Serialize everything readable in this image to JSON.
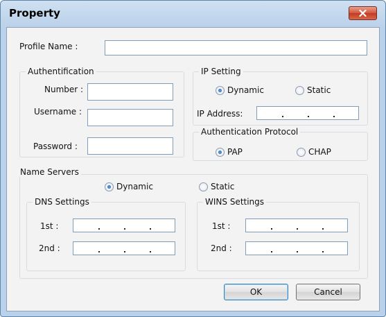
{
  "window": {
    "title": "Property"
  },
  "profile": {
    "label": "Profile Name :",
    "value": ""
  },
  "authentication": {
    "group_label": "Authentification",
    "number_label": "Number :",
    "username_label": "Username :",
    "password_label": "Password  :",
    "number_value": "",
    "username_value": "",
    "password_value": ""
  },
  "ip_setting": {
    "group_label": "IP Setting",
    "dynamic_label": "Dynamic",
    "static_label": "Static",
    "selected": "Dynamic",
    "ip_address_label": "IP Address:",
    "ip_address_value": ""
  },
  "auth_protocol": {
    "group_label": "Authentication Protocol",
    "pap_label": "PAP",
    "chap_label": "CHAP",
    "selected": "PAP"
  },
  "name_servers": {
    "group_label": "Name Servers",
    "dynamic_label": "Dynamic",
    "static_label": "Static",
    "selected": "Dynamic",
    "dns": {
      "group_label": "DNS Settings",
      "first_label": "1st :",
      "second_label": "2nd :",
      "first_value": "",
      "second_value": ""
    },
    "wins": {
      "group_label": "WINS Settings",
      "first_label": "1st :",
      "second_label": "2nd :",
      "first_value": "",
      "second_value": ""
    }
  },
  "buttons": {
    "ok_label": "OK",
    "cancel_label": "Cancel"
  },
  "colors": {
    "title_bar": "#b9d1ea",
    "close_button": "#c23a22",
    "dialog_background": "#f3f3f3",
    "radio_checked": "#1a55a8"
  }
}
